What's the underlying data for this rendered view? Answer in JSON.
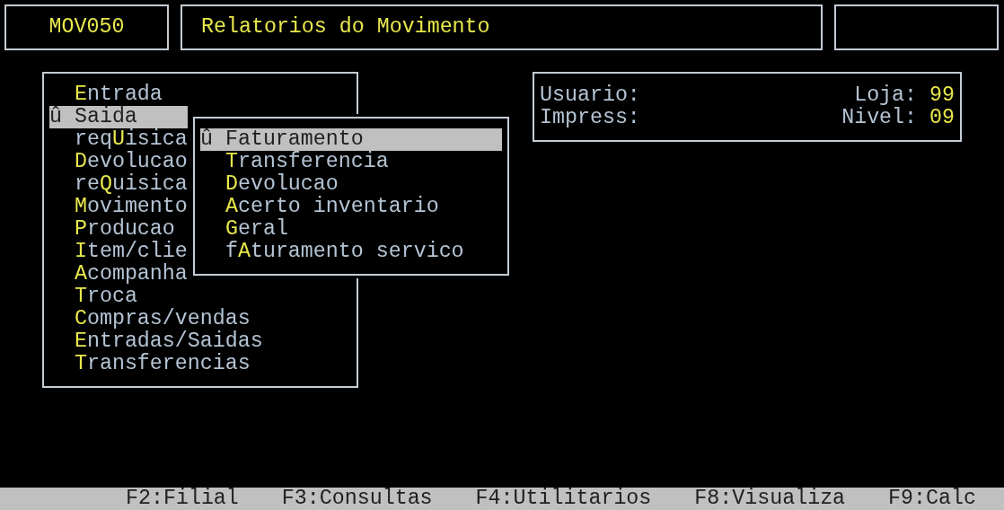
{
  "header": {
    "program_code": "MOV050",
    "title": "Relatorios do Movimento"
  },
  "menu": {
    "items": [
      {
        "hotkey": "E",
        "label_end": "ntrada",
        "selected": false
      },
      {
        "marker": "û",
        "label": "Saida",
        "selected": true
      },
      {
        "label_start": "req",
        "hotkey": "U",
        "label_end": "isica",
        "selected": false
      },
      {
        "hotkey": "D",
        "label_end": "evolucao",
        "selected": false
      },
      {
        "label_start": "re",
        "hotkey": "Q",
        "label_end": "uisica",
        "selected": false
      },
      {
        "hotkey": "M",
        "label_end": "ovimento",
        "selected": false
      },
      {
        "hotkey": "P",
        "label_end": "roducao",
        "selected": false
      },
      {
        "hotkey": "I",
        "label_end": "tem/clie",
        "selected": false
      },
      {
        "hotkey": "A",
        "label_end": "companha",
        "selected": false
      },
      {
        "hotkey": "T",
        "label_end": "roca",
        "selected": false
      },
      {
        "hotkey": "C",
        "label_end": "ompras/vendas",
        "selected": false
      },
      {
        "hotkey": "E",
        "label_end": "ntradas/Saidas",
        "selected": false
      },
      {
        "hotkey": "T",
        "label_end": "ransferencias",
        "selected": false
      }
    ]
  },
  "submenu": {
    "items": [
      {
        "marker": "û",
        "label": "Faturamento",
        "selected": true
      },
      {
        "hotkey": "T",
        "label_end": "ransferencia",
        "selected": false
      },
      {
        "hotkey": "D",
        "label_end": "evolucao",
        "selected": false
      },
      {
        "hotkey": "A",
        "label_end": "certo inventario",
        "selected": false
      },
      {
        "hotkey": "G",
        "label_end": "eral",
        "selected": false
      },
      {
        "label_start": "f",
        "hotkey": "A",
        "label_end": "turamento servico",
        "selected": false
      }
    ]
  },
  "info": {
    "rows": [
      {
        "label": "Usuario:",
        "right_label": "Loja:",
        "right_value": "99"
      },
      {
        "label": "Impress:",
        "right_label": "Nivel:",
        "right_value": "09"
      }
    ]
  },
  "status_bar": {
    "function_keys": [
      "F2:Filial",
      "F3:Consultas",
      "F4:Utilitarios",
      "F8:Visualiza",
      "F9:Calc"
    ]
  }
}
